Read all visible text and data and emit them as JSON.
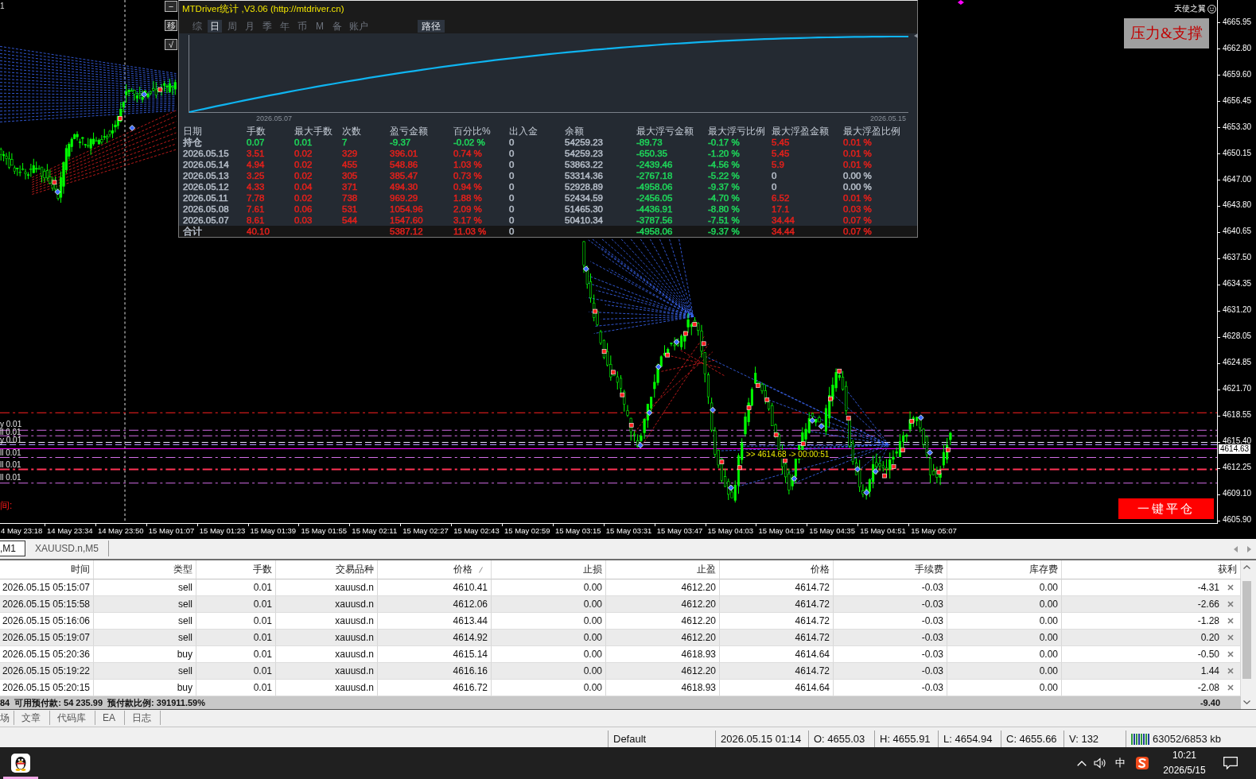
{
  "chart": {
    "corner_label": "1",
    "side_buttons": [
      {
        "label": "−"
      },
      {
        "label": "移"
      },
      {
        "label": "√"
      }
    ],
    "stats_panel": {
      "title": "MTDriver统计 ,V3.06 (http://mtdriver.cn)",
      "tabs": [
        {
          "label": "综",
          "selected": false
        },
        {
          "label": "日",
          "selected": true
        },
        {
          "label": "周",
          "selected": false
        },
        {
          "label": "月",
          "selected": false
        },
        {
          "label": "季",
          "selected": false
        },
        {
          "label": "年",
          "selected": false
        },
        {
          "label": "币",
          "selected": false
        },
        {
          "label": "M",
          "selected": false
        },
        {
          "label": "备",
          "selected": false
        },
        {
          "label": "账户",
          "selected": false
        }
      ],
      "path_button": "路径",
      "curve_labels": [
        "2026.05.07",
        "2026.05.15"
      ],
      "columns": [
        "日期",
        "手数",
        "最大手数",
        "次数",
        "盈亏金额",
        "百分比%",
        "出入金",
        "余额",
        "最大浮亏金额",
        "最大浮亏比例",
        "最大浮盈金额",
        "最大浮盈比例"
      ],
      "rows": [
        {
          "kind": "data",
          "date": {
            "text": "持仓",
            "color": "#b6bec9"
          },
          "lots": {
            "text": "0.07",
            "color": "#1ed65a"
          },
          "max_lots": {
            "text": "0.01",
            "color": "#1ed65a"
          },
          "trades": {
            "text": "7",
            "color": "#1ed65a"
          },
          "pnl": {
            "text": "-9.37",
            "color": "#1ed65a"
          },
          "pnl_pct": {
            "text": "-0.02 %",
            "color": "#1ed65a"
          },
          "deposit": {
            "text": "0",
            "color": "#b6bec9"
          },
          "balance": {
            "text": "54259.23",
            "color": "#b6bec9"
          },
          "max_float_loss": {
            "text": "-89.73",
            "color": "#1ed65a"
          },
          "max_float_loss_pct": {
            "text": "-0.17 %",
            "color": "#1ed65a"
          },
          "max_float_profit": {
            "text": "5.45",
            "color": "#e3201b"
          },
          "max_float_profit_pct": {
            "text": "0.01 %",
            "color": "#e3201b"
          }
        },
        {
          "kind": "data",
          "date": {
            "text": "2026.05.15",
            "color": "#b6bec9"
          },
          "lots": {
            "text": "3.51",
            "color": "#e3201b"
          },
          "max_lots": {
            "text": "0.02",
            "color": "#e3201b"
          },
          "trades": {
            "text": "329",
            "color": "#e3201b"
          },
          "pnl": {
            "text": "396.01",
            "color": "#e3201b"
          },
          "pnl_pct": {
            "text": "0.74 %",
            "color": "#e3201b"
          },
          "deposit": {
            "text": "0",
            "color": "#b6bec9"
          },
          "balance": {
            "text": "54259.23",
            "color": "#b6bec9"
          },
          "max_float_loss": {
            "text": "-650.35",
            "color": "#1ed65a"
          },
          "max_float_loss_pct": {
            "text": "-1.20 %",
            "color": "#1ed65a"
          },
          "max_float_profit": {
            "text": "5.45",
            "color": "#e3201b"
          },
          "max_float_profit_pct": {
            "text": "0.01 %",
            "color": "#e3201b"
          }
        },
        {
          "kind": "data",
          "date": {
            "text": "2026.05.14",
            "color": "#b6bec9"
          },
          "lots": {
            "text": "4.94",
            "color": "#e3201b"
          },
          "max_lots": {
            "text": "0.02",
            "color": "#e3201b"
          },
          "trades": {
            "text": "455",
            "color": "#e3201b"
          },
          "pnl": {
            "text": "548.86",
            "color": "#e3201b"
          },
          "pnl_pct": {
            "text": "1.03 %",
            "color": "#e3201b"
          },
          "deposit": {
            "text": "0",
            "color": "#b6bec9"
          },
          "balance": {
            "text": "53863.22",
            "color": "#b6bec9"
          },
          "max_float_loss": {
            "text": "-2439.46",
            "color": "#1ed65a"
          },
          "max_float_loss_pct": {
            "text": "-4.56 %",
            "color": "#1ed65a"
          },
          "max_float_profit": {
            "text": "5.9",
            "color": "#e3201b"
          },
          "max_float_profit_pct": {
            "text": "0.01 %",
            "color": "#e3201b"
          }
        },
        {
          "kind": "data",
          "date": {
            "text": "2026.05.13",
            "color": "#b6bec9"
          },
          "lots": {
            "text": "3.25",
            "color": "#e3201b"
          },
          "max_lots": {
            "text": "0.02",
            "color": "#e3201b"
          },
          "trades": {
            "text": "305",
            "color": "#e3201b"
          },
          "pnl": {
            "text": "385.47",
            "color": "#e3201b"
          },
          "pnl_pct": {
            "text": "0.73 %",
            "color": "#e3201b"
          },
          "deposit": {
            "text": "0",
            "color": "#b6bec9"
          },
          "balance": {
            "text": "53314.36",
            "color": "#b6bec9"
          },
          "max_float_loss": {
            "text": "-2767.18",
            "color": "#1ed65a"
          },
          "max_float_loss_pct": {
            "text": "-5.22 %",
            "color": "#1ed65a"
          },
          "max_float_profit": {
            "text": "0",
            "color": "#b6bec9"
          },
          "max_float_profit_pct": {
            "text": "0.00 %",
            "color": "#b6bec9"
          }
        },
        {
          "kind": "data",
          "date": {
            "text": "2026.05.12",
            "color": "#b6bec9"
          },
          "lots": {
            "text": "4.33",
            "color": "#e3201b"
          },
          "max_lots": {
            "text": "0.04",
            "color": "#e3201b"
          },
          "trades": {
            "text": "371",
            "color": "#e3201b"
          },
          "pnl": {
            "text": "494.30",
            "color": "#e3201b"
          },
          "pnl_pct": {
            "text": "0.94 %",
            "color": "#e3201b"
          },
          "deposit": {
            "text": "0",
            "color": "#b6bec9"
          },
          "balance": {
            "text": "52928.89",
            "color": "#b6bec9"
          },
          "max_float_loss": {
            "text": "-4958.06",
            "color": "#1ed65a"
          },
          "max_float_loss_pct": {
            "text": "-9.37 %",
            "color": "#1ed65a"
          },
          "max_float_profit": {
            "text": "0",
            "color": "#b6bec9"
          },
          "max_float_profit_pct": {
            "text": "0.00 %",
            "color": "#b6bec9"
          }
        },
        {
          "kind": "data",
          "date": {
            "text": "2026.05.11",
            "color": "#b6bec9"
          },
          "lots": {
            "text": "7.78",
            "color": "#e3201b"
          },
          "max_lots": {
            "text": "0.02",
            "color": "#e3201b"
          },
          "trades": {
            "text": "738",
            "color": "#e3201b"
          },
          "pnl": {
            "text": "969.29",
            "color": "#e3201b"
          },
          "pnl_pct": {
            "text": "1.88 %",
            "color": "#e3201b"
          },
          "deposit": {
            "text": "0",
            "color": "#b6bec9"
          },
          "balance": {
            "text": "52434.59",
            "color": "#b6bec9"
          },
          "max_float_loss": {
            "text": "-2456.05",
            "color": "#1ed65a"
          },
          "max_float_loss_pct": {
            "text": "-4.70 %",
            "color": "#1ed65a"
          },
          "max_float_profit": {
            "text": "6.52",
            "color": "#e3201b"
          },
          "max_float_profit_pct": {
            "text": "0.01 %",
            "color": "#e3201b"
          }
        },
        {
          "kind": "data",
          "date": {
            "text": "2026.05.08",
            "color": "#b6bec9"
          },
          "lots": {
            "text": "7.61",
            "color": "#e3201b"
          },
          "max_lots": {
            "text": "0.06",
            "color": "#e3201b"
          },
          "trades": {
            "text": "531",
            "color": "#e3201b"
          },
          "pnl": {
            "text": "1054.96",
            "color": "#e3201b"
          },
          "pnl_pct": {
            "text": "2.09 %",
            "color": "#e3201b"
          },
          "deposit": {
            "text": "0",
            "color": "#b6bec9"
          },
          "balance": {
            "text": "51465.30",
            "color": "#b6bec9"
          },
          "max_float_loss": {
            "text": "-4436.91",
            "color": "#1ed65a"
          },
          "max_float_loss_pct": {
            "text": "-8.80 %",
            "color": "#1ed65a"
          },
          "max_float_profit": {
            "text": "17.1",
            "color": "#e3201b"
          },
          "max_float_profit_pct": {
            "text": "0.03 %",
            "color": "#e3201b"
          }
        },
        {
          "kind": "data",
          "date": {
            "text": "2026.05.07",
            "color": "#b6bec9"
          },
          "lots": {
            "text": "8.61",
            "color": "#e3201b"
          },
          "max_lots": {
            "text": "0.03",
            "color": "#e3201b"
          },
          "trades": {
            "text": "544",
            "color": "#e3201b"
          },
          "pnl": {
            "text": "1547.60",
            "color": "#e3201b"
          },
          "pnl_pct": {
            "text": "3.17 %",
            "color": "#e3201b"
          },
          "deposit": {
            "text": "0",
            "color": "#b6bec9"
          },
          "balance": {
            "text": "50410.34",
            "color": "#b6bec9"
          },
          "max_float_loss": {
            "text": "-3787.56",
            "color": "#1ed65a"
          },
          "max_float_loss_pct": {
            "text": "-7.51 %",
            "color": "#1ed65a"
          },
          "max_float_profit": {
            "text": "34.44",
            "color": "#e3201b"
          },
          "max_float_profit_pct": {
            "text": "0.07 %",
            "color": "#e3201b"
          }
        },
        {
          "kind": "total",
          "date": {
            "text": "合计",
            "color": "#b6bec9"
          },
          "lots": {
            "text": "40.10",
            "color": "#e3201b"
          },
          "pnl": {
            "text": "5387.12",
            "color": "#e3201b"
          },
          "pnl_pct": {
            "text": "11.03 %",
            "color": "#e3201b"
          },
          "deposit": {
            "text": "0",
            "color": "#b6bec9"
          },
          "max_float_loss": {
            "text": "-4958.06",
            "color": "#1ed65a"
          },
          "max_float_loss_pct": {
            "text": "-9.37 %",
            "color": "#1ed65a"
          },
          "max_float_profit": {
            "text": "34.44",
            "color": "#e3201b"
          },
          "max_float_profit_pct": {
            "text": "0.07 %",
            "color": "#e3201b"
          }
        }
      ]
    },
    "order_labels": [
      "y 0.01",
      "ll 0.01",
      "y 0.01",
      "ll 0.01",
      "ll 0.01",
      "ll 0.01"
    ],
    "left_note": "间:",
    "countdown_label": ">> 4614.68 -> 00:00:51",
    "brand": "天使之翼",
    "sr_button": "压力&支撑",
    "close_all_button": "一键平仓",
    "price_axis": {
      "labels": [
        "4665.95",
        "4662.80",
        "4659.60",
        "4656.45",
        "4653.30",
        "4650.15",
        "4647.00",
        "4643.80",
        "4640.65",
        "4637.50",
        "4634.35",
        "4631.20",
        "4628.05",
        "4624.85",
        "4621.70",
        "4618.55",
        "4615.40",
        "4612.25",
        "4609.10",
        "4605.90"
      ],
      "current_price": "4614.63"
    },
    "time_axis": [
      "4 May 23:18",
      "14 May 23:34",
      "14 May 23:50",
      "15 May 01:07",
      "15 May 01:23",
      "15 May 01:39",
      "15 May 01:55",
      "15 May 02:11",
      "15 May 02:27",
      "15 May 02:43",
      "15 May 02:59",
      "15 May 03:15",
      "15 May 03:31",
      "15 May 03:47",
      "15 May 04:03",
      "15 May 04:19",
      "15 May 04:35",
      "15 May 04:51",
      "15 May 05:07"
    ]
  },
  "chart_tabs": [
    {
      "label": ",M1",
      "selected": true
    },
    {
      "label": "XAUUSD.n,M5",
      "selected": false
    }
  ],
  "trade_table": {
    "columns": [
      {
        "label": "时间",
        "sorted": false
      },
      {
        "label": "类型",
        "sorted": false
      },
      {
        "label": "手数",
        "sorted": false
      },
      {
        "label": "交易品种",
        "sorted": false
      },
      {
        "label": "价格",
        "sorted": true
      },
      {
        "label": "止损",
        "sorted": false
      },
      {
        "label": "止盈",
        "sorted": false
      },
      {
        "label": "价格",
        "sorted": false
      },
      {
        "label": "手续费",
        "sorted": false
      },
      {
        "label": "库存费",
        "sorted": false
      },
      {
        "label": "获利",
        "sorted": false
      }
    ],
    "rows": [
      [
        "2026.05.15 05:15:07",
        "sell",
        "0.01",
        "xauusd.n",
        "4610.41",
        "0.00",
        "4612.20",
        "4614.72",
        "-0.03",
        "0.00",
        "-4.31"
      ],
      [
        "2026.05.15 05:15:58",
        "sell",
        "0.01",
        "xauusd.n",
        "4612.06",
        "0.00",
        "4612.20",
        "4614.72",
        "-0.03",
        "0.00",
        "-2.66"
      ],
      [
        "2026.05.15 05:16:06",
        "sell",
        "0.01",
        "xauusd.n",
        "4613.44",
        "0.00",
        "4612.20",
        "4614.72",
        "-0.03",
        "0.00",
        "-1.28"
      ],
      [
        "2026.05.15 05:19:07",
        "sell",
        "0.01",
        "xauusd.n",
        "4614.92",
        "0.00",
        "4612.20",
        "4614.72",
        "-0.03",
        "0.00",
        "0.20"
      ],
      [
        "2026.05.15 05:20:36",
        "buy",
        "0.01",
        "xauusd.n",
        "4615.14",
        "0.00",
        "4618.93",
        "4614.64",
        "-0.03",
        "0.00",
        "-0.50"
      ],
      [
        "2026.05.15 05:19:22",
        "sell",
        "0.01",
        "xauusd.n",
        "4616.16",
        "0.00",
        "4612.20",
        "4614.72",
        "-0.03",
        "0.00",
        "1.44"
      ],
      [
        "2026.05.15 05:20:15",
        "buy",
        "0.01",
        "xauusd.n",
        "4616.72",
        "0.00",
        "4618.93",
        "4614.64",
        "-0.03",
        "0.00",
        "-2.08"
      ]
    ],
    "summary": "84  可用预付款: 54 235.99  预付款比例: 391911.59%",
    "summary_total": "-9.40"
  },
  "terminal_tabs": [
    "场",
    "文章",
    "代码库",
    "EA",
    "日志"
  ],
  "status_bar": {
    "profile": "Default",
    "datetime": "2026.05.15 01:14",
    "open": "O: 4655.03",
    "high": "H: 4655.91",
    "low": "L: 4654.94",
    "close": "C: 4655.66",
    "volume": "V: 132",
    "traffic": "63052/6853 kb"
  },
  "taskbar": {
    "ime": "中",
    "time": "10:21",
    "date": "2026/5/15"
  }
}
